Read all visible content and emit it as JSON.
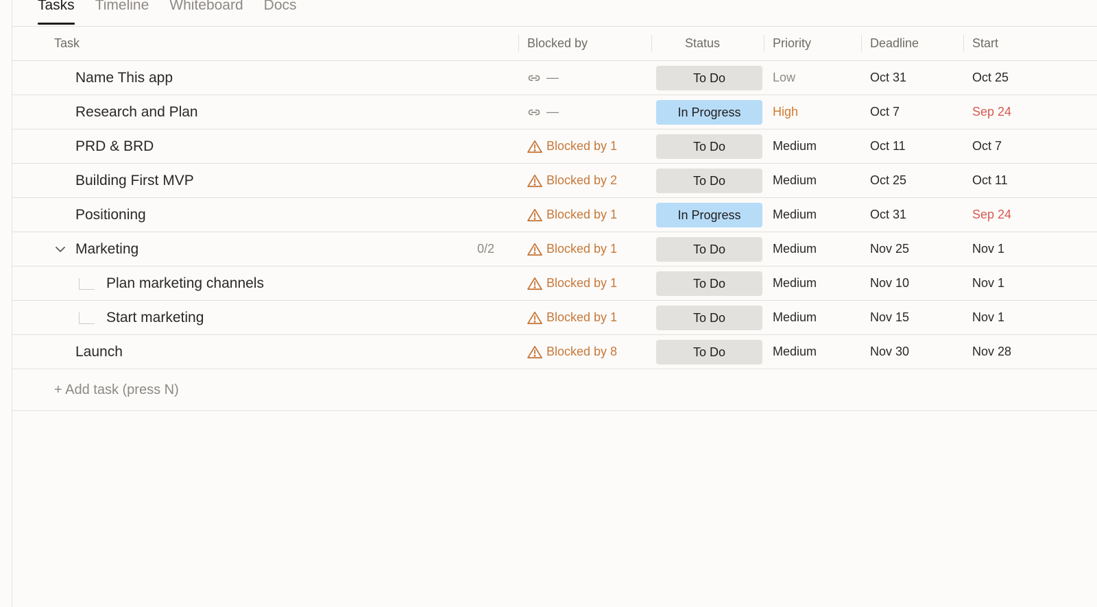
{
  "tabs": [
    {
      "label": "Tasks",
      "active": true
    },
    {
      "label": "Timeline",
      "active": false
    },
    {
      "label": "Whiteboard",
      "active": false
    },
    {
      "label": "Docs",
      "active": false
    }
  ],
  "columns": {
    "task": "Task",
    "blocked_by": "Blocked by",
    "status": "Status",
    "priority": "Priority",
    "deadline": "Deadline",
    "start": "Start"
  },
  "colors": {
    "todo_pill": "#e3e1dd",
    "in_progress_pill": "#b7dcf8",
    "blocked_text": "#c6783a",
    "priority_high": "#d07a30",
    "overdue_date": "#d45a52"
  },
  "rows": [
    {
      "name": "Name This app",
      "blocked": "—",
      "blocked_icon": "link-icon",
      "status": "To Do",
      "priority": "Low",
      "deadline": "Oct 31",
      "start": "Oct 25"
    },
    {
      "name": "Research and Plan",
      "blocked": "—",
      "blocked_icon": "link-icon",
      "status": "In Progress",
      "priority": "High",
      "deadline": "Oct 7",
      "start": "Sep 24"
    },
    {
      "name": "PRD & BRD",
      "blocked": "Blocked by 1",
      "blocked_icon": "warning-icon",
      "status": "To Do",
      "priority": "Medium",
      "deadline": "Oct 11",
      "start": "Oct 7"
    },
    {
      "name": "Building First MVP",
      "blocked": "Blocked by 2",
      "blocked_icon": "warning-icon",
      "status": "To Do",
      "priority": "Medium",
      "deadline": "Oct 25",
      "start": "Oct 11"
    },
    {
      "name": "Positioning",
      "blocked": "Blocked by 1",
      "blocked_icon": "warning-icon",
      "status": "In Progress",
      "priority": "Medium",
      "deadline": "Oct 31",
      "start": "Sep 24"
    },
    {
      "name": "Marketing",
      "subtask_count": "0/2",
      "blocked": "Blocked by 1",
      "blocked_icon": "warning-icon",
      "status": "To Do",
      "priority": "Medium",
      "deadline": "Nov 25",
      "start": "Nov 1"
    },
    {
      "name": "Plan marketing channels",
      "blocked": "Blocked by 1",
      "blocked_icon": "warning-icon",
      "status": "To Do",
      "priority": "Medium",
      "deadline": "Nov 10",
      "start": "Nov 1"
    },
    {
      "name": "Start marketing",
      "blocked": "Blocked by 1",
      "blocked_icon": "warning-icon",
      "status": "To Do",
      "priority": "Medium",
      "deadline": "Nov 15",
      "start": "Nov 1"
    },
    {
      "name": "Launch",
      "blocked": "Blocked by 8",
      "blocked_icon": "warning-icon",
      "status": "To Do",
      "priority": "Medium",
      "deadline": "Nov 30",
      "start": "Nov 28"
    }
  ],
  "add_task_label": "+ Add task (press N)"
}
